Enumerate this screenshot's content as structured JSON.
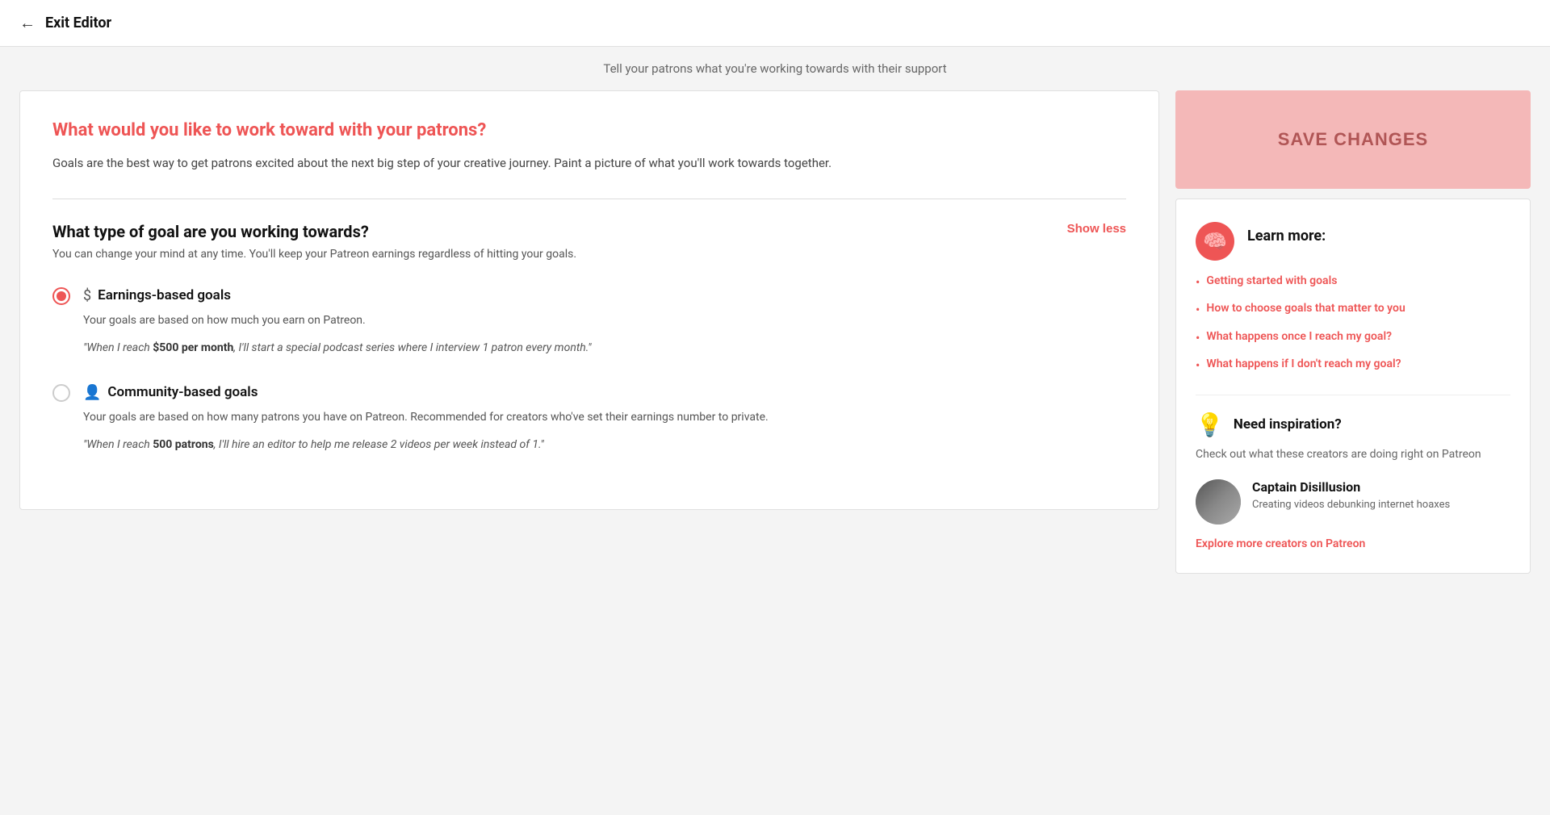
{
  "header": {
    "back_label": "←",
    "title": "Exit Editor"
  },
  "subtitle": "Tell your patrons what you're working towards with their support",
  "left": {
    "section_title": "What would you like to work toward with your patrons?",
    "intro_text": "Goals are the best way to get patrons excited about the next big step of your creative journey. Paint a picture of what you'll work towards together.",
    "goal_type_title": "What type of goal are you working towards?",
    "show_less_label": "Show less",
    "goal_type_subtitle": "You can change your mind at any time. You'll keep your Patreon earnings regardless of hitting your goals.",
    "goals": [
      {
        "id": "earnings",
        "label": "Earnings-based goals",
        "selected": true,
        "description": "Your goals are based on how much you earn on Patreon.",
        "example": "\"When I reach $500 per month, I'll start a special podcast series where I interview 1 patron every month.\""
      },
      {
        "id": "community",
        "label": "Community-based goals",
        "selected": false,
        "description": "Your goals are based on how many patrons you have on Patreon. Recommended for creators who've set their earnings number to private.",
        "example": "\"When I reach 500 patrons, I'll hire an editor to help me release 2 videos per week instead of 1.\""
      }
    ]
  },
  "right": {
    "save_changes_label": "SAVE CHANGES",
    "learn_more": {
      "title": "Learn more:",
      "links": [
        {
          "text": "Getting started with goals"
        },
        {
          "text": "How to choose goals that matter to you"
        },
        {
          "text": "What happens once I reach my goal?"
        },
        {
          "text": "What happens if I don't reach my goal?"
        }
      ]
    },
    "inspiration": {
      "title": "Need inspiration?",
      "description": "Check out what these creators are doing right on Patreon",
      "creator": {
        "name": "Captain Disillusion",
        "description": "Creating videos debunking internet hoaxes"
      },
      "explore_label": "Explore more creators on Patreon"
    }
  }
}
